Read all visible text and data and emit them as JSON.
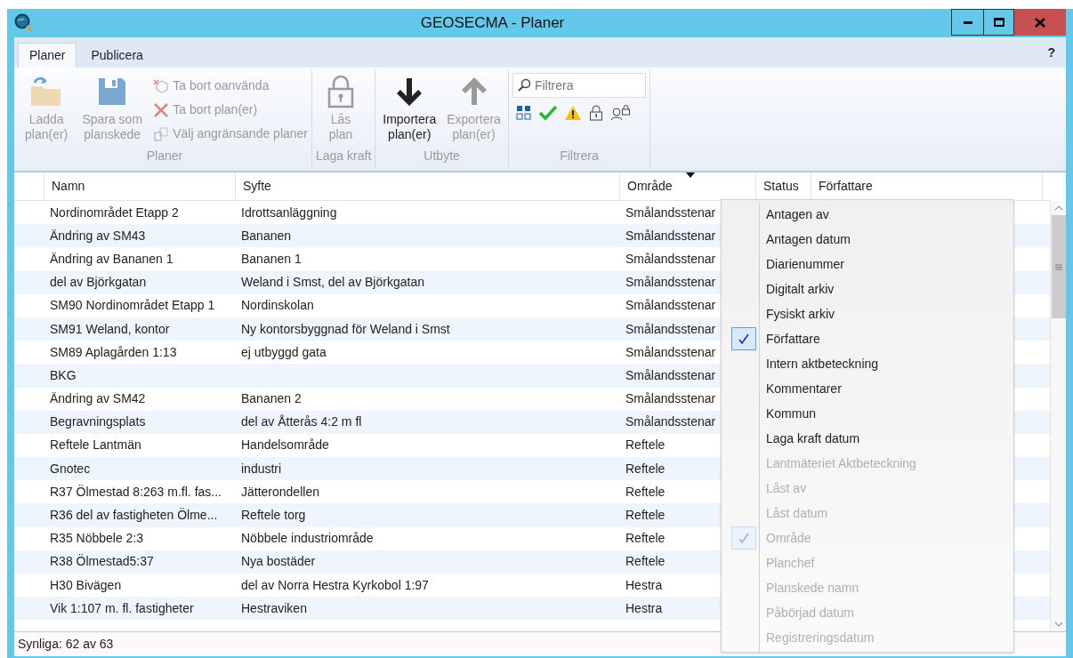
{
  "window": {
    "title": "GEOSECMA - Planer"
  },
  "tabs": [
    {
      "label": "Planer",
      "selected": true
    },
    {
      "label": "Publicera",
      "selected": false
    }
  ],
  "help": "?",
  "ribbon": {
    "groups": [
      {
        "label": "Planer",
        "large": [
          {
            "kind": "load",
            "label": "Ladda plan(er)",
            "disabled": true
          },
          {
            "kind": "save",
            "label": "Spara som planskede",
            "disabled": true
          }
        ],
        "small": [
          {
            "kind": "cleanup",
            "label": "Ta bort oanvända",
            "disabled": true
          },
          {
            "kind": "delete",
            "label": "Ta bort plan(er)",
            "disabled": true
          },
          {
            "kind": "adjacent",
            "label": "Välj angränsande planer",
            "disabled": true
          }
        ]
      },
      {
        "label": "Laga kraft",
        "large": [
          {
            "kind": "lock",
            "label": "Lås plan",
            "disabled": true
          }
        ]
      },
      {
        "label": "Utbyte",
        "large": [
          {
            "kind": "import",
            "label": "Importera plan(er)",
            "disabled": false
          },
          {
            "kind": "export",
            "label": "Exportera plan(er)",
            "disabled": true
          }
        ]
      },
      {
        "label": "Filtrera",
        "filter": {
          "placeholder": "Filtrera",
          "toggles": [
            {
              "kind": "grid"
            },
            {
              "kind": "check"
            },
            {
              "kind": "warning"
            },
            {
              "kind": "lock"
            },
            {
              "kind": "user-lock"
            }
          ]
        }
      }
    ]
  },
  "table": {
    "columns": [
      {
        "label": "Namn"
      },
      {
        "label": "Syfte"
      },
      {
        "label": "Område",
        "sorted": true
      },
      {
        "label": "Status"
      },
      {
        "label": "Författare"
      }
    ],
    "rows": [
      [
        "Nordinområdet Etapp 2",
        "Idrottsanläggning",
        "Smålandsstenar"
      ],
      [
        "Ändring av SM43",
        "Bananen",
        "Smålandsstenar"
      ],
      [
        "Ändring av Bananen 1",
        "Bananen 1",
        "Smålandsstenar"
      ],
      [
        "del av Björkgatan",
        "Weland i Smst, del av Björkgatan",
        "Smålandsstenar"
      ],
      [
        "SM90 Nordinområdet Etapp 1",
        "Nordinskolan",
        "Smålandsstenar"
      ],
      [
        "SM91 Weland, kontor",
        "Ny kontorsbyggnad för Weland i Smst",
        "Smålandsstenar"
      ],
      [
        "SM89 Aplagården 1:13",
        "ej utbyggd gata",
        "Smålandsstenar"
      ],
      [
        "BKG",
        "",
        "Smålandsstenar"
      ],
      [
        "Ändring av SM42",
        "Bananen 2",
        "Smålandsstenar"
      ],
      [
        "Begravningsplats",
        "del av Åtterås 4:2 m fl",
        "Smålandsstenar"
      ],
      [
        "Reftele Lantmän",
        "Handelsområde",
        "Reftele"
      ],
      [
        "Gnotec",
        "industri",
        "Reftele"
      ],
      [
        "R37 Ölmestad 8:263 m.fl. fas...",
        "Jätterondellen",
        "Reftele"
      ],
      [
        "R36 del av fastigheten Ölme...",
        "Reftele torg",
        "Reftele"
      ],
      [
        "R35 Nöbbele 2:3",
        "Nöbbele industriområde",
        "Reftele"
      ],
      [
        "R38 Ölmestad5:37",
        "Nya bostäder",
        "Reftele"
      ],
      [
        "H30 Bivägen",
        "del av Norra Hestra Kyrkobol 1:97",
        "Hestra"
      ],
      [
        "Vik 1:107 m. fl. fastigheter",
        "Hestraviken",
        "Hestra"
      ]
    ]
  },
  "column_menu": {
    "items": [
      {
        "label": "Antagen av",
        "checked": false,
        "faded": false
      },
      {
        "label": "Antagen datum",
        "checked": false,
        "faded": false
      },
      {
        "label": "Diarienummer",
        "checked": false,
        "faded": false
      },
      {
        "label": "Digitalt arkiv",
        "checked": false,
        "faded": false
      },
      {
        "label": "Fysiskt arkiv",
        "checked": false,
        "faded": false
      },
      {
        "label": "Författare",
        "checked": true,
        "faded": false
      },
      {
        "label": "Intern aktbeteckning",
        "checked": false,
        "faded": false
      },
      {
        "label": "Kommentarer",
        "checked": false,
        "faded": false
      },
      {
        "label": "Kommun",
        "checked": false,
        "faded": false
      },
      {
        "label": "Laga kraft datum",
        "checked": false,
        "faded": false
      },
      {
        "label": "Lantmäteriet Aktbeteckning",
        "checked": false,
        "faded": true
      },
      {
        "label": "Låst av",
        "checked": false,
        "faded": true
      },
      {
        "label": "Låst datum",
        "checked": false,
        "faded": true
      },
      {
        "label": "Område",
        "checked": true,
        "faded": true
      },
      {
        "label": "Planchef",
        "checked": false,
        "faded": true
      },
      {
        "label": "Planskede namn",
        "checked": false,
        "faded": true
      },
      {
        "label": "Påbörjad datum",
        "checked": false,
        "faded": true
      },
      {
        "label": "Registreringsdatum",
        "checked": false,
        "faded": true
      }
    ]
  },
  "status_bar": "Synliga: 62 av 63"
}
